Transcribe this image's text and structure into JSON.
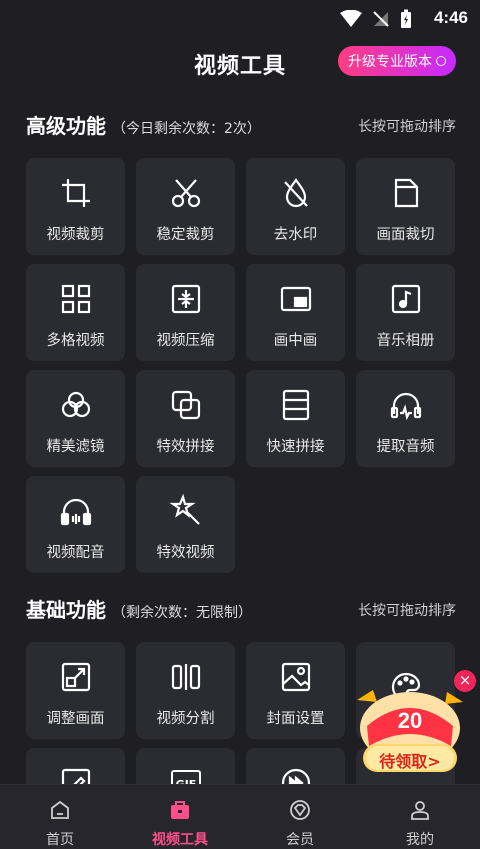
{
  "status_bar": {
    "time": "4:46"
  },
  "header": {
    "title": "视频工具",
    "pro_button": "升级专业版本"
  },
  "advanced": {
    "title": "高级功能",
    "subtitle": "（今日剩余次数：2次）",
    "hint": "长按可拖动排序",
    "items": [
      {
        "label": "视频裁剪",
        "icon": "crop-icon"
      },
      {
        "label": "稳定裁剪",
        "icon": "scissors-icon"
      },
      {
        "label": "去水印",
        "icon": "droplet-slash-icon"
      },
      {
        "label": "画面裁切",
        "icon": "page-cut-icon"
      },
      {
        "label": "多格视频",
        "icon": "grid-icon"
      },
      {
        "label": "视频压缩",
        "icon": "compress-icon"
      },
      {
        "label": "画中画",
        "icon": "pip-icon"
      },
      {
        "label": "音乐相册",
        "icon": "music-album-icon"
      },
      {
        "label": "精美滤镜",
        "icon": "filter-icon"
      },
      {
        "label": "特效拼接",
        "icon": "layers-icon"
      },
      {
        "label": "快速拼接",
        "icon": "rows-icon"
      },
      {
        "label": "提取音频",
        "icon": "headphone-wave-icon"
      },
      {
        "label": "视频配音",
        "icon": "headphones-icon"
      },
      {
        "label": "特效视频",
        "icon": "magic-wand-icon"
      }
    ]
  },
  "basic": {
    "title": "基础功能",
    "subtitle": "（剩余次数：无限制）",
    "hint": "长按可拖动排序",
    "items": [
      {
        "label": "调整画面",
        "icon": "resize-icon"
      },
      {
        "label": "视频分割",
        "icon": "split-icon"
      },
      {
        "label": "封面设置",
        "icon": "image-icon"
      },
      {
        "label": "",
        "icon": "palette-icon"
      }
    ],
    "partial_items": [
      {
        "icon": "edit-icon"
      },
      {
        "icon": "gif-icon",
        "text": "GIF"
      },
      {
        "icon": "fast-forward-icon"
      },
      {
        "icon": "unknown-icon"
      }
    ]
  },
  "promo": {
    "amount": "20",
    "button": "待领取>"
  },
  "nav": [
    {
      "label": "首页",
      "icon": "home-icon",
      "active": false
    },
    {
      "label": "视频工具",
      "icon": "toolbox-icon",
      "active": true
    },
    {
      "label": "会员",
      "icon": "vip-diamond-icon",
      "active": false
    },
    {
      "label": "我的",
      "icon": "user-icon",
      "active": false
    }
  ],
  "colors": {
    "accent": "#ff4f8a",
    "background": "#1e1e23",
    "tile": "#2b2b32"
  }
}
